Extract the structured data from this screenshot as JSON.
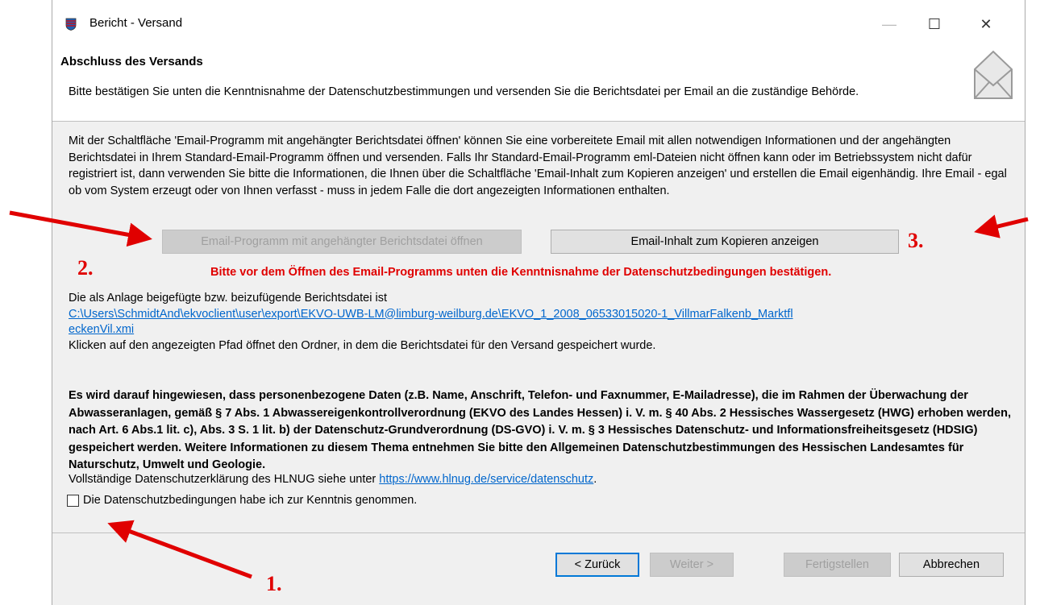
{
  "window": {
    "title": "Bericht - Versand",
    "minimize_glyph": "—",
    "maximize_glyph": "☐",
    "close_glyph": "✕"
  },
  "header": {
    "title": "Abschluss des Versands",
    "description": "Bitte bestätigen Sie unten die Kenntnisnahme der Datenschutzbestimmungen und versenden Sie die Berichtsdatei per Email an die zuständige Behörde.",
    "icon": "envelope-icon"
  },
  "info": {
    "paragraph": "Mit der Schaltfläche 'Email-Programm mit angehängter Berichtsdatei öffnen' können Sie eine vorbereitete Email mit allen notwendigen Informationen und der angehängten Berichtsdatei in Ihrem Standard-Email-Programm öffnen und versenden. Falls Ihr Standard-Email-Programm eml-Dateien nicht öffnen kann oder im Betriebssystem nicht dafür registriert ist, dann verwenden Sie bitte die Informationen, die Ihnen über die Schaltfläche 'Email-Inhalt zum Kopieren anzeigen' und erstellen die Email eigenhändig. Ihre Email - egal ob vom System erzeugt oder von Ihnen verfasst - muss in jedem Falle die dort angezeigten Informationen enthalten."
  },
  "buttons": {
    "open_email_program": "Email-Programm mit angehängter Berichtsdatei öffnen",
    "show_email_content": "Email-Inhalt zum Kopieren anzeigen"
  },
  "warning": "Bitte vor dem Öffnen des Email-Programms unten die Kenntnisnahme der Datenschutzbedingungen bestätigen.",
  "attachment": {
    "intro": "Die als Anlage beigefügte bzw. beizufügende Berichtsdatei ist",
    "path": "C:\\Users\\SchmidtAnd\\ekvoclient\\user\\export\\EKVO-UWB-LM@limburg-weilburg.de\\EKVO_1_2008_06533015020-1_VillmarFalkenb_MarktfleckenVil.xmi",
    "hint": "Klicken auf den angezeigten Pfad öffnet den Ordner, in dem die Berichtsdatei für den Versand gespeichert wurde."
  },
  "legal": "Es wird darauf hingewiesen, dass personenbezogene Daten (z.B. Name, Anschrift, Telefon- und Faxnummer, E-Mailadresse), die im Rahmen der Überwachung der Abwasseranlagen, gemäß § 7 Abs. 1 Abwassereigenkontrollverordnung (EKVO des Landes Hessen) i. V. m. § 40 Abs. 2 Hessisches Wassergesetz (HWG) erhoben werden, nach Art. 6 Abs.1 lit. c), Abs. 3 S. 1 lit. b) der Datenschutz-Grundverordnung (DS-GVO) i. V. m. § 3 Hessisches Datenschutz- und Informationsfreiheitsgesetz (HDSIG) gespeichert werden. Weitere Informationen zu diesem Thema entnehmen Sie bitte den Allgemeinen Datenschutzbestimmungen des Hessischen Landesamtes für Naturschutz, Umwelt und Geologie.",
  "privacy": {
    "text": "Vollständige Datenschutzerklärung des HLNUG siehe unter ",
    "link": "https://www.hlnug.de/service/datenschutz",
    "suffix": "."
  },
  "checkbox": {
    "label": "Die Datenschutzbedingungen habe ich zur Kenntnis genommen.",
    "checked": false
  },
  "footer": {
    "back": "< Zurück",
    "next": "Weiter >",
    "finish": "Fertigstellen",
    "cancel": "Abbrechen"
  },
  "annotations": {
    "one": "1.",
    "two": "2.",
    "three": "3.",
    "color": "#e00000"
  }
}
